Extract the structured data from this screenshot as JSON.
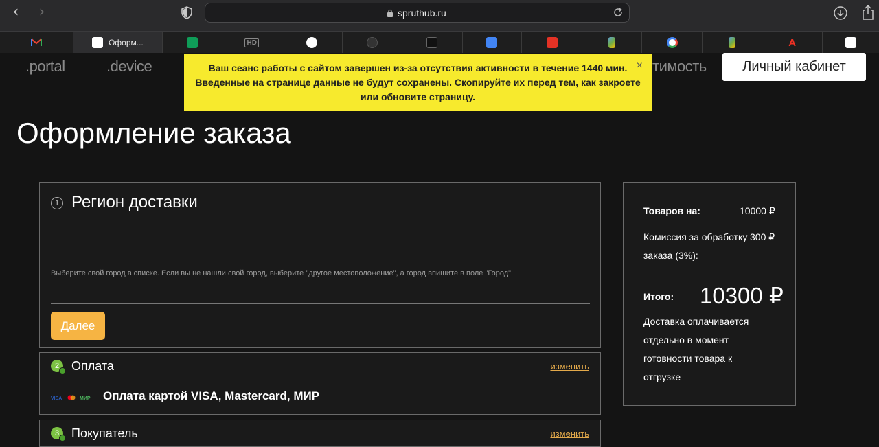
{
  "browser": {
    "url": "spruthub.ru",
    "tabs": [
      {
        "icon": "gmail-icon",
        "label": "",
        "color": "#ea4335",
        "active": false
      },
      {
        "icon": "spruthub-favicon",
        "label": "Оформ...",
        "color": "#ffffff",
        "active": true
      },
      {
        "icon": "google-sheets-icon",
        "label": "",
        "color": "#0f9d58",
        "active": false
      },
      {
        "icon": "hd-icon",
        "label": "",
        "color": "#888888",
        "active": false
      },
      {
        "icon": "arrow-circle-icon",
        "label": "",
        "color": "#ffffff",
        "active": false
      },
      {
        "icon": "bomb-icon",
        "label": "",
        "color": "#333333",
        "active": false
      },
      {
        "icon": "dark-square-icon",
        "label": "",
        "color": "#222222",
        "active": false
      },
      {
        "icon": "google-translate-icon",
        "label": "",
        "color": "#4285f4",
        "active": false
      },
      {
        "icon": "aliexpress-icon",
        "label": "",
        "color": "#e43225",
        "active": false
      },
      {
        "icon": "colorful-p-icon",
        "label": "",
        "color": "#5b9bd5",
        "active": false
      },
      {
        "icon": "google-icon",
        "label": "",
        "color": "#4285f4",
        "active": false
      },
      {
        "icon": "colorful-p-icon",
        "label": "",
        "color": "#5b9bd5",
        "active": false
      },
      {
        "icon": "alfabank-icon",
        "label": "",
        "color": "#ef3124",
        "active": false
      },
      {
        "icon": "spruthub-favicon",
        "label": "",
        "color": "#ffffff",
        "active": false
      }
    ]
  },
  "site_nav": {
    "portal": ".portal",
    "device": ".device",
    "cost": "тимость",
    "account": "Личный кабинет"
  },
  "alert": {
    "line1": "Ваш сеанс работы с сайтом завершен из-за отсутствия активности в течение 1440 мин.",
    "line2": "Введенные на странице данные не будут сохранены. Скопируйте их перед тем, как закроете",
    "line3": "или обновите страницу.",
    "close": "×",
    "color": "#f7ea2d"
  },
  "page": {
    "title": "Оформление заказа"
  },
  "region": {
    "step": "1",
    "title": "Регион доставки",
    "hint": "Выберите свой город в списке. Если вы не нашли свой город, выберите \"другое местоположение\", а город впишите в поле \"Город\"",
    "next": "Далее"
  },
  "payment": {
    "step": "2",
    "title": "Оплата",
    "change": "изменить",
    "method": "Оплата картой VISA, Mastercard, МИР"
  },
  "buyer": {
    "step": "3",
    "title": "Покупатель",
    "change": "изменить"
  },
  "summary": {
    "goods_label": "Товаров на:",
    "goods_value": "10000 ₽",
    "fee_label_1": "Комиссия за обработку",
    "fee_label_2": "заказа (3%):",
    "fee_value": "300 ₽",
    "total_label": "Итого:",
    "total_value": "10300 ₽",
    "delivery_note": "Доставка оплачивается отдельно в момент готовности товара к отгрузке"
  },
  "colors": {
    "accent": "#f6b443",
    "link": "#e3a94a",
    "done": "#7cc243"
  }
}
